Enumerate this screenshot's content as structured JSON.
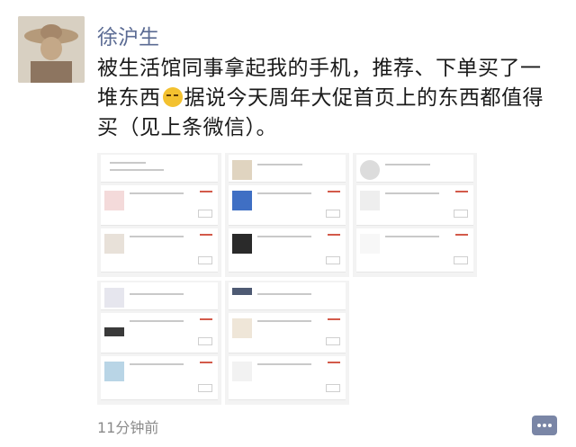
{
  "post": {
    "author": "徐沪生",
    "text_before_emoji": "被生活馆同事拿起我的手机，推荐、下单买了一堆东西",
    "emoji": "grinning-face-emoji",
    "text_after_emoji": "据说今天周年大促首页上的东西都值得买（见上条微信）。",
    "time": "11分钟前"
  },
  "colors": {
    "author_link": "#5b6b93",
    "timestamp": "#8a8a8a",
    "comment_button": "#7a86a6",
    "price_red": "#d35a4a"
  },
  "icons": {
    "comment": "comment-dots-icon"
  }
}
